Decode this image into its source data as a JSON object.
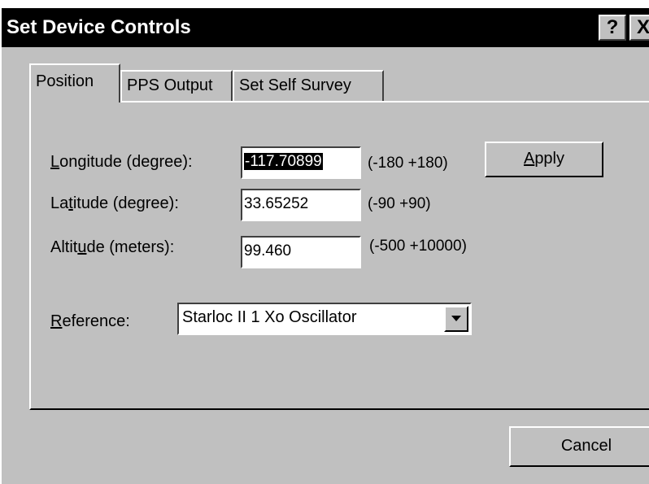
{
  "window": {
    "title": "Set Device Controls",
    "help_label": "?",
    "close_label": "X"
  },
  "tabs": [
    {
      "label": "Position",
      "active": true
    },
    {
      "label": "PPS Output",
      "active": false
    },
    {
      "label": "Set Self Survey",
      "active": false
    }
  ],
  "fields": {
    "longitude": {
      "label_pre": "",
      "label_access": "L",
      "label_post": "ongitude (degree):",
      "value": "-117.70899",
      "range": "(-180  +180)"
    },
    "latitude": {
      "label_pre": "La",
      "label_access": "t",
      "label_post": "itude (degree):",
      "value": "33.65252",
      "range": "(-90  +90)"
    },
    "altitude": {
      "label_pre": "Altit",
      "label_access": "u",
      "label_post": "de (meters):",
      "value": "99.460",
      "range": "(-500 +10000)"
    }
  },
  "reference": {
    "label_access": "R",
    "label_post": "eference:",
    "selected": "Starloc II 1 Xo Oscillator"
  },
  "buttons": {
    "apply_access": "A",
    "apply_post": "pply",
    "cancel": "Cancel"
  },
  "icons": {
    "dropdown": "chevron-down-icon"
  }
}
